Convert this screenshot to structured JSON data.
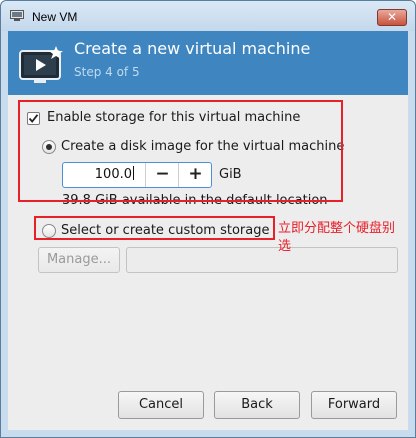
{
  "window": {
    "title": "New VM",
    "close_label": "✕"
  },
  "header": {
    "title": "Create a new virtual machine",
    "step": "Step 4 of 5",
    "icon": "monitor-star-icon"
  },
  "storage": {
    "enable_label": "Enable storage for this virtual machine",
    "enable_checked": true,
    "create_disk_label": "Create a disk image for the virtual machine",
    "create_disk_selected": true,
    "disk_size_value": "100.0",
    "disk_size_unit": "GiB",
    "decrement_label": "−",
    "increment_label": "+",
    "available_text": "39.8 GiB available in the default location",
    "custom_label": "Select or create custom storage",
    "custom_selected": false,
    "manage_label": "Manage...",
    "custom_path_value": ""
  },
  "annotation": {
    "text": "立即分配整个硬盘别选",
    "color": "#e8202a"
  },
  "buttons": {
    "cancel": "Cancel",
    "back": "Back",
    "forward": "Forward"
  },
  "colors": {
    "header_bg": "#3f86c0",
    "accent_focus": "#4a90d9",
    "annotation_red": "#e8202a"
  }
}
